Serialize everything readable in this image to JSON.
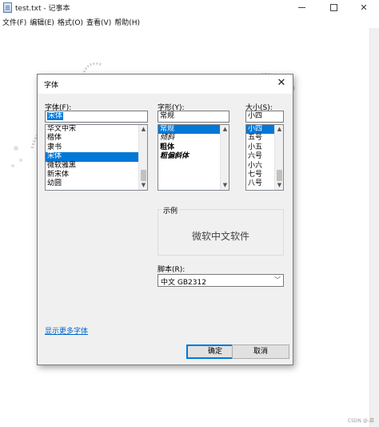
{
  "window": {
    "title": "test.txt - 记事本",
    "menu": [
      "文件(F)",
      "编辑(E)",
      "格式(O)",
      "查看(V)",
      "帮助(H)"
    ],
    "close_glyph": "✕"
  },
  "watermark": "CSDN @-慕",
  "dialog": {
    "title": "字体",
    "close_glyph": "✕",
    "font": {
      "label": "字体(F):",
      "value": "宋体",
      "items": [
        "华文中宋",
        "楷体",
        "隶书",
        "宋体",
        "微软雅黑",
        "新宋体",
        "幼圆"
      ],
      "selected_index": 3
    },
    "style": {
      "label": "字形(Y):",
      "value": "常规",
      "items": [
        "常规",
        "倾斜",
        "粗体",
        "粗偏斜体"
      ],
      "selected_index": 0
    },
    "size": {
      "label": "大小(S):",
      "value": "小四",
      "items": [
        "小四",
        "五号",
        "小五",
        "六号",
        "小六",
        "七号",
        "八号"
      ],
      "selected_index": 0
    },
    "sample": {
      "label": "示例",
      "text": "微软中文软件"
    },
    "script": {
      "label": "脚本(R):",
      "value": "中文 GB2312"
    },
    "more_fonts_link": "显示更多字体",
    "ok_label": "确定",
    "cancel_label": "取消"
  },
  "colors": {
    "selection": "#0078d7",
    "link": "#0066cc",
    "dialog_bg": "#f0f0f0"
  },
  "icons": {
    "scroll_up": "▲",
    "scroll_down": "▼",
    "combo_arrow": "﹀"
  }
}
